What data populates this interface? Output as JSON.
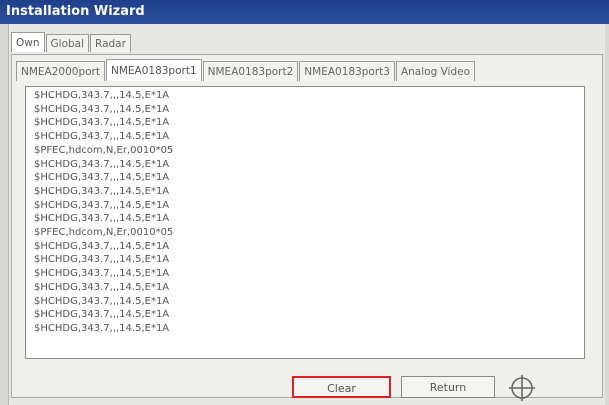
{
  "window": {
    "title": "Installation Wizard"
  },
  "outer_tabs": [
    {
      "label": "Own",
      "active": true
    },
    {
      "label": "Global",
      "active": false
    },
    {
      "label": "Radar",
      "active": false
    }
  ],
  "inner_tabs": [
    {
      "label": "NMEA2000port",
      "active": false
    },
    {
      "label": "NMEA0183port1",
      "active": true
    },
    {
      "label": "NMEA0183port2",
      "active": false
    },
    {
      "label": "NMEA0183port3",
      "active": false
    },
    {
      "label": "Analog Video",
      "active": false
    }
  ],
  "log_lines": [
    "$HCHDG,343.7,,,14.5,E*1A",
    "$HCHDG,343.7,,,14.5,E*1A",
    "$HCHDG,343.7,,,14.5,E*1A",
    "$HCHDG,343.7,,,14.5,E*1A",
    "$PFEC,hdcom,N,Er,0010*05",
    "$HCHDG,343.7,,,14.5,E*1A",
    "$HCHDG,343.7,,,14.5,E*1A",
    "$HCHDG,343.7,,,14.5,E*1A",
    "$HCHDG,343.7,,,14.5,E*1A",
    "$HCHDG,343.7,,,14.5,E*1A",
    "$PFEC,hdcom,N,Er,0010*05",
    "$HCHDG,343.7,,,14.5,E*1A",
    "$HCHDG,343.7,,,14.5,E*1A",
    "$HCHDG,343.7,,,14.5,E*1A",
    "$HCHDG,343.7,,,14.5,E*1A",
    "$HCHDG,343.7,,,14.5,E*1A",
    "$HCHDG,343.7,,,14.5,E*1A",
    "$HCHDG,343.7,,,14.5,E*1A"
  ],
  "buttons": {
    "clear_label": "Clear",
    "return_label": "Return"
  },
  "icons": {
    "crosshair": "crosshair-icon"
  },
  "colors": {
    "titlebar": "#2c4f9c",
    "highlight": "#e02020"
  }
}
